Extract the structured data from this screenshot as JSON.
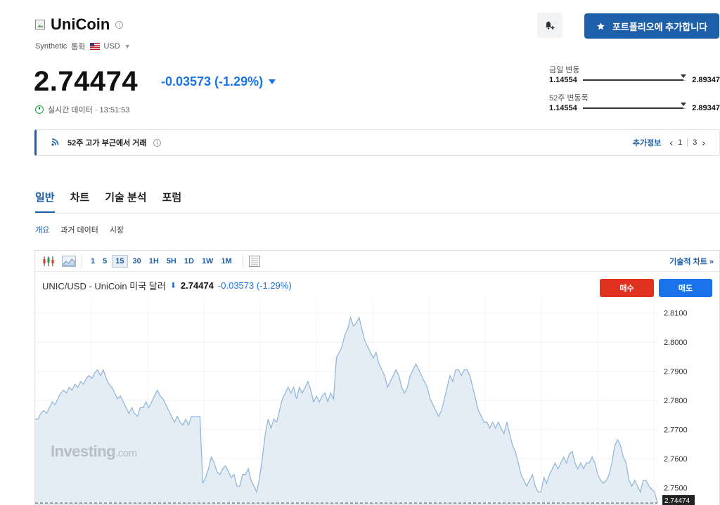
{
  "header": {
    "coin_name": "UniCoin",
    "category": "Synthetic",
    "currency_type": "통화",
    "currency": "USD",
    "price": "2.74474",
    "change": "-0.03573 (-1.29%)",
    "time_label": "실시간 데이터 · 13:51:53"
  },
  "actions": {
    "portfolio_label": "포트폴리오에 추가합니다"
  },
  "ranges": {
    "day": {
      "label": "금일 변동",
      "low": "1.14554",
      "high": "2.89347",
      "position": 0.97
    },
    "week52": {
      "label": "52주 변동폭",
      "low": "1.14554",
      "high": "2.89347",
      "position": 0.97
    }
  },
  "banner": {
    "text": "52주 고가 부근에서 거래",
    "more_info": "추가정보",
    "page_current": "1",
    "page_total": "3"
  },
  "tabs": [
    "일반",
    "차트",
    "기술 분석",
    "포럼"
  ],
  "subtabs": [
    "개요",
    "과거 데이터",
    "시장"
  ],
  "chart_toolbar": {
    "timeframes": [
      "1",
      "5",
      "15",
      "30",
      "1H",
      "5H",
      "1D",
      "1W",
      "1M"
    ],
    "active_timeframe": "15",
    "technical_link": "기술적 차트 »"
  },
  "chart_header": {
    "symbol": "UNIC/USD - UniCoin 미국 달러",
    "price": "2.74474",
    "change": "-0.03573 (-1.29%)",
    "sell_label": "매수",
    "buy_label": "매도"
  },
  "watermark": {
    "brand": "Investing",
    "domain": ".com"
  },
  "colors": {
    "accent": "#1d5fa8",
    "change_blue": "#1a73e8",
    "sell_red": "#e0301e",
    "area_fill": "#e4ecf4",
    "area_line": "#8fb4d8"
  },
  "chart_data": {
    "type": "area",
    "ylim": [
      2.745,
      2.815
    ],
    "yticks": [
      "2.8100",
      "2.8000",
      "2.7900",
      "2.7800",
      "2.7700",
      "2.7600",
      "2.7500"
    ],
    "current_label": "2.74474",
    "values": [
      2.7735,
      2.7735,
      2.7755,
      2.7765,
      2.7755,
      2.7775,
      2.7795,
      2.7785,
      2.7805,
      2.7825,
      2.7835,
      2.7825,
      2.7845,
      2.7835,
      2.7855,
      2.7845,
      2.7865,
      2.7855,
      2.7875,
      2.7885,
      2.7875,
      2.7895,
      2.7905,
      2.7885,
      2.7905,
      2.7875,
      2.7855,
      2.7845,
      2.7825,
      2.7805,
      2.7815,
      2.7795,
      2.7775,
      2.7755,
      2.7775,
      2.7755,
      2.7745,
      2.7775,
      2.7775,
      2.7795,
      2.7775,
      2.7795,
      2.7815,
      2.7835,
      2.7815,
      2.7805,
      2.7785,
      2.7765,
      2.7745,
      2.7725,
      2.7745,
      2.7725,
      2.7715,
      2.7735,
      2.7715,
      2.7745,
      2.7745,
      2.7745,
      2.7745,
      2.7515,
      2.7535,
      2.7565,
      2.7605,
      2.7585,
      2.7555,
      2.7545,
      2.7565,
      2.7575,
      2.7555,
      2.7535,
      2.7545,
      2.7505,
      2.7505,
      2.7545,
      2.7545,
      2.7565,
      2.7525,
      2.7505,
      2.7485,
      2.7535,
      2.7605,
      2.7685,
      2.7735,
      2.7705,
      2.7735,
      2.7725,
      2.7765,
      2.7805,
      2.7825,
      2.7845,
      2.7825,
      2.7845,
      2.7805,
      2.7845,
      2.7825,
      2.7845,
      2.7865,
      2.7835,
      2.7795,
      2.7815,
      2.7795,
      2.7815,
      2.7825,
      2.7795,
      2.7825,
      2.7805,
      2.7945,
      2.7965,
      2.7985,
      2.8025,
      2.8045,
      2.8085,
      2.8055,
      2.8065,
      2.8085,
      2.8045,
      2.8005,
      2.7985,
      2.7965,
      2.7945,
      2.7965,
      2.7925,
      2.7905,
      2.7885,
      2.7845,
      2.7865,
      2.7885,
      2.7905,
      2.7885,
      2.7845,
      2.7825,
      2.7845,
      2.7885,
      2.7905,
      2.7925,
      2.7905,
      2.7885,
      2.7865,
      2.7845,
      2.7805,
      2.7785,
      2.7765,
      2.7745,
      2.7765,
      2.7805,
      2.7845,
      2.7885,
      2.7865,
      2.7905,
      2.7905,
      2.7885,
      2.7905,
      2.7905,
      2.7885,
      2.7845,
      2.7805,
      2.7765,
      2.7745,
      2.7725,
      2.7725,
      2.7705,
      2.7725,
      2.7705,
      2.7725,
      2.7705,
      2.7685,
      2.7725,
      2.7685,
      2.7645,
      2.7625,
      2.7585,
      2.7545,
      2.7525,
      2.7505,
      2.7525,
      2.7545,
      2.7505,
      2.7485,
      2.7485,
      2.7535,
      2.7515,
      2.7545,
      2.7565,
      2.7585,
      2.7565,
      2.7585,
      2.7605,
      2.7585,
      2.7615,
      2.7625,
      2.7585,
      2.7565,
      2.7585,
      2.7565,
      2.7585,
      2.7585,
      2.7605,
      2.7585,
      2.7545,
      2.7525,
      2.7515,
      2.7525,
      2.7545,
      2.7585,
      2.7645,
      2.7665,
      2.7645,
      2.7605,
      2.7585,
      2.7525,
      2.7505,
      2.7525,
      2.7505,
      2.7485,
      2.7525,
      2.7525,
      2.7505,
      2.7495,
      2.7485,
      2.74474
    ]
  }
}
